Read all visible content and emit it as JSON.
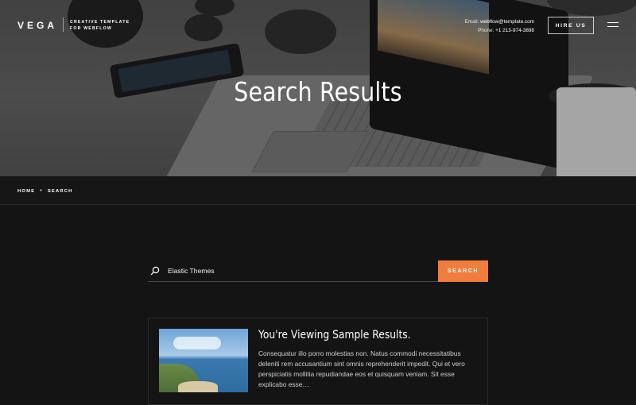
{
  "brand": {
    "name": "VEGA",
    "tagline_line1": "CREATIVE TEMPLATE",
    "tagline_line2": "FOR WEBFLOW"
  },
  "contact": {
    "email_label": "Email:",
    "email": "webflow@template.com",
    "phone_label": "Phone:",
    "phone": "+1 213-974-3898"
  },
  "nav": {
    "hire_label": "HIRE US",
    "menu_icon": "hamburger-menu-icon"
  },
  "hero": {
    "title": "Search Results"
  },
  "breadcrumb": {
    "items": [
      "HOME",
      "SEARCH"
    ],
    "separator": "•"
  },
  "search": {
    "value": "Elastic Themes",
    "button_label": "SEARCH",
    "icon": "search-icon"
  },
  "result": {
    "title": "You're Viewing Sample Results.",
    "excerpt": "Consequatur illo porro molestias non. Natus commodi necessitatibus deleniti rem accusantium sint omnis reprehenderit impedit. Qui et vero perspiciatis mollitia repudiandae eos et quisquam veniam. Sit esse explicabo esse…"
  },
  "colors": {
    "accent": "#f07d3c",
    "background": "#141414"
  }
}
